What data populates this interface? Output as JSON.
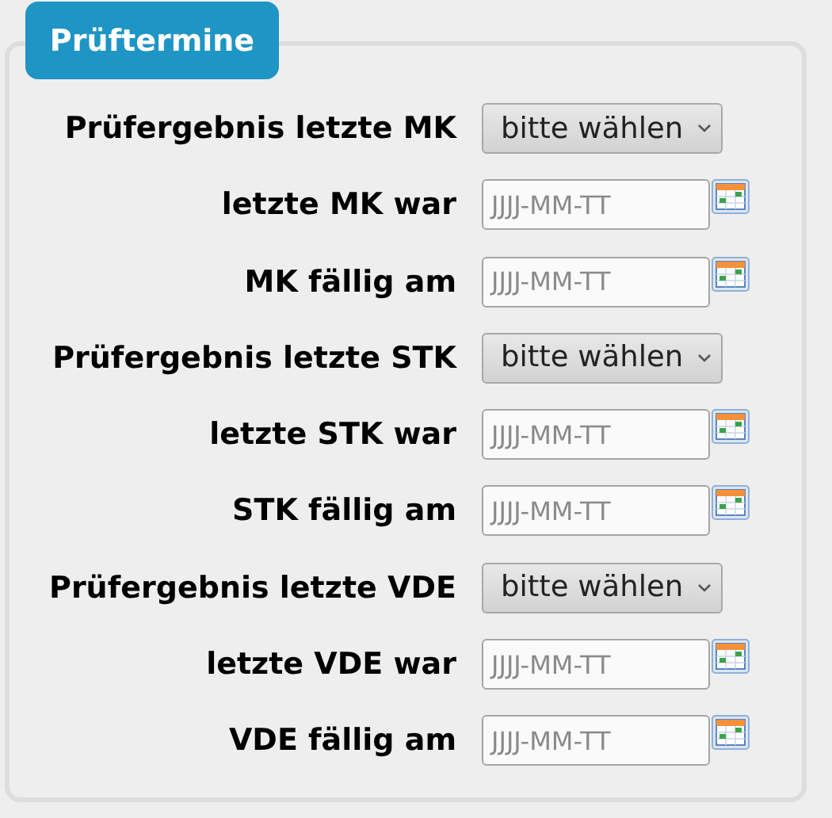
{
  "legend": "Prüftermine",
  "rows": [
    {
      "kind": "select",
      "label": "Prüfergebnis letzte MK",
      "value": "bitte wählen"
    },
    {
      "kind": "date",
      "label": "letzte MK war",
      "placeholder": "JJJJ-MM-TT"
    },
    {
      "kind": "date",
      "label": "MK fällig am",
      "placeholder": "JJJJ-MM-TT"
    },
    {
      "kind": "select",
      "label": "Prüfergebnis letzte STK",
      "value": "bitte wählen"
    },
    {
      "kind": "date",
      "label": "letzte STK war",
      "placeholder": "JJJJ-MM-TT"
    },
    {
      "kind": "date",
      "label": "STK fällig am",
      "placeholder": "JJJJ-MM-TT"
    },
    {
      "kind": "select",
      "label": "Prüfergebnis letzte VDE",
      "value": "bitte wählen"
    },
    {
      "kind": "date",
      "label": "letzte VDE war",
      "placeholder": "JJJJ-MM-TT"
    },
    {
      "kind": "date",
      "label": "VDE fällig am",
      "placeholder": "JJJJ-MM-TT"
    }
  ]
}
